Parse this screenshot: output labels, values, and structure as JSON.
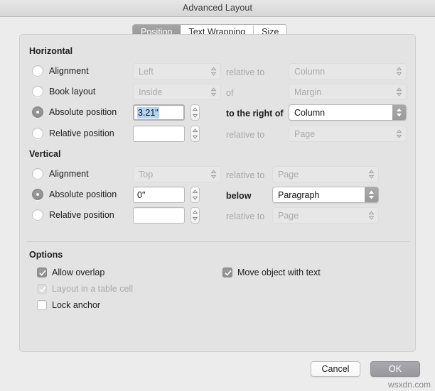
{
  "window": {
    "title": "Advanced Layout"
  },
  "tabs": [
    {
      "label": "Position",
      "selected": true
    },
    {
      "label": "Text Wrapping",
      "selected": false
    },
    {
      "label": "Size",
      "selected": false
    }
  ],
  "horizontal": {
    "title": "Horizontal",
    "rows": [
      {
        "radio_label": "Alignment",
        "selected": false,
        "value": "Left",
        "value_enabled": false,
        "mid_label": "relative to",
        "mid_enabled": false,
        "target": "Column",
        "target_enabled": false
      },
      {
        "radio_label": "Book layout",
        "selected": false,
        "value": "Inside",
        "value_enabled": false,
        "mid_label": "of",
        "mid_enabled": false,
        "target": "Margin",
        "target_enabled": false
      },
      {
        "radio_label": "Absolute position",
        "selected": true,
        "value": "3.21\"",
        "value_enabled": true,
        "mid_label": "to the right of",
        "mid_enabled": true,
        "target": "Column",
        "target_enabled": true
      },
      {
        "radio_label": "Relative position",
        "selected": false,
        "value": "",
        "value_enabled": true,
        "mid_label": "relative to",
        "mid_enabled": false,
        "target": "Page",
        "target_enabled": false
      }
    ]
  },
  "vertical": {
    "title": "Vertical",
    "rows": [
      {
        "radio_label": "Alignment",
        "selected": false,
        "value": "Top",
        "value_enabled": false,
        "mid_label": "relative to",
        "mid_enabled": false,
        "target": "Page",
        "target_enabled": false
      },
      {
        "radio_label": "Absolute position",
        "selected": true,
        "value": "0\"",
        "value_enabled": true,
        "mid_label": "below",
        "mid_enabled": true,
        "target": "Paragraph",
        "target_enabled": true
      },
      {
        "radio_label": "Relative position",
        "selected": false,
        "value": "",
        "value_enabled": true,
        "mid_label": "relative to",
        "mid_enabled": false,
        "target": "Page",
        "target_enabled": false
      }
    ]
  },
  "options": {
    "title": "Options",
    "left": [
      {
        "label": "Allow overlap",
        "checked": true,
        "enabled": true
      },
      {
        "label": "Layout in a table cell",
        "checked": true,
        "enabled": false
      },
      {
        "label": "Lock anchor",
        "checked": false,
        "enabled": true
      }
    ],
    "right": [
      {
        "label": "Move object with text",
        "checked": true,
        "enabled": true
      }
    ]
  },
  "footer": {
    "cancel_label": "Cancel",
    "ok_label": "OK"
  },
  "watermark": "wsxdn.com",
  "colors": {
    "window_bg": "#ececec",
    "panel_bg": "#e3e3e3",
    "accent_control": "#9a9a9a",
    "selection_highlight": "#b3d4f5",
    "disabled_text": "#a9a9a9"
  }
}
